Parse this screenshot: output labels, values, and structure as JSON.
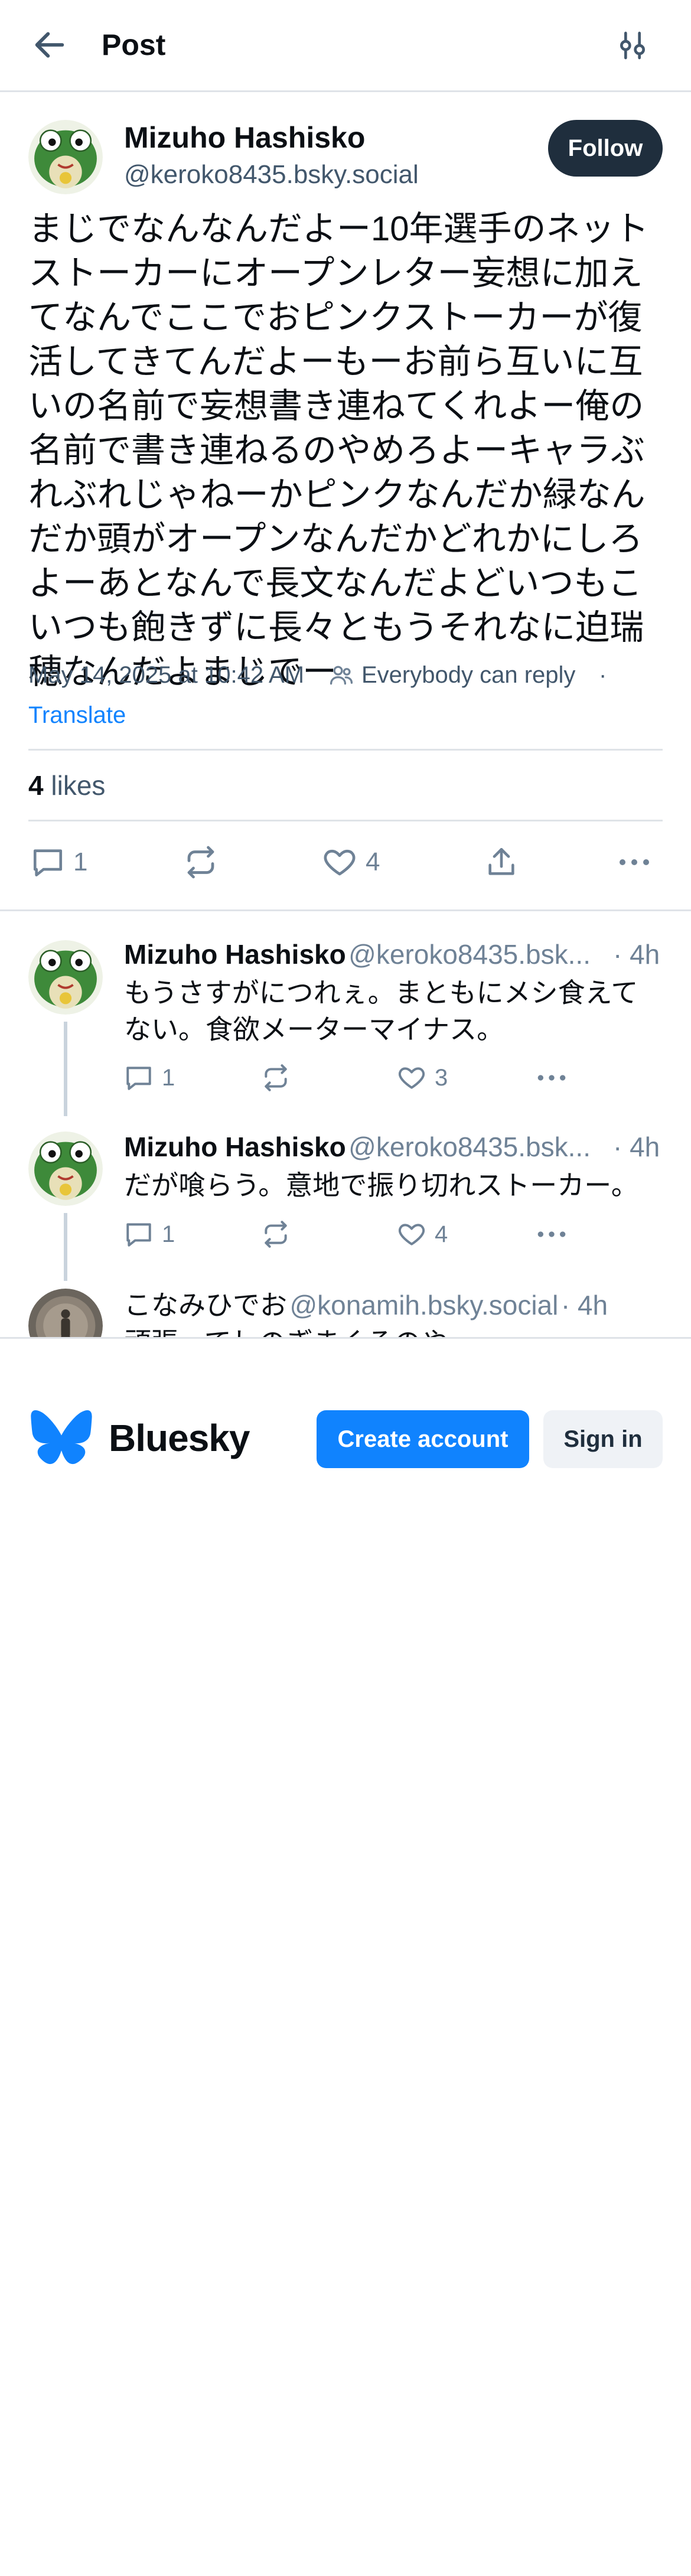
{
  "header": {
    "title": "Post"
  },
  "post": {
    "author_name": "Mizuho Hashisko",
    "author_handle": "@keroko8435.bsky.social",
    "follow_label": "Follow",
    "text": "まじでなんなんだよー10年選手のネットストーカーにオープンレター妄想に加えてなんでここでおピンクストーカーが復活してきてんだよーもーお前ら互いに互いの名前で妄想書き連ねてくれよー俺の名前で書き連ねるのやめろよーキャラぶれぶれじゃねーかピンクなんだか緑なんだか頭がオープンなんだかどれかにしろよーあとなんで長文なんだよどいつもこいつも飽きずに長々ともうそれなに迫瑞穂なんだよまじでー",
    "date": "May 14, 2025 at 10:42 AM",
    "reply_setting": "Everybody can reply",
    "meta_separator": "·",
    "translate_label": "Translate",
    "likes_count": "4",
    "likes_label": "likes",
    "reply_count": "1",
    "like_count": "4"
  },
  "replies": [
    {
      "name": "Mizuho Hashisko",
      "handle": "@keroko8435.bsk...",
      "time": "· 4h",
      "text": "もうさすがにつれぇ。まともにメシ食えてない。食欲メーターマイナス。",
      "reply_count": "1",
      "like_count": "3"
    },
    {
      "name": "Mizuho Hashisko",
      "handle": "@keroko8435.bsk...",
      "time": "· 4h",
      "text": "だが喰らう。意地で振り切れストーカー。",
      "reply_count": "1",
      "like_count": "4"
    },
    {
      "name": "こなみひでお",
      "handle": "@konamih.bsky.social",
      "time": "· 4h",
      "text": "頑張ってしのぎまくるのや"
    }
  ],
  "bottom": {
    "brand": "Bluesky",
    "create_label": "Create account",
    "signin_label": "Sign in"
  },
  "icons": {
    "back": "arrow-left-icon",
    "settings": "sliders-icon",
    "people": "people-icon",
    "reply": "speech-bubble-icon",
    "repost": "repost-icon",
    "like": "heart-icon",
    "share": "share-icon",
    "more": "ellipsis-icon",
    "logo": "butterfly-icon"
  },
  "colors": {
    "accent": "#1083fe",
    "follow_bg": "#1f2e3d",
    "muted_text": "#42576c",
    "icon_gray": "#6f8296",
    "divider": "#dfe3e8"
  }
}
